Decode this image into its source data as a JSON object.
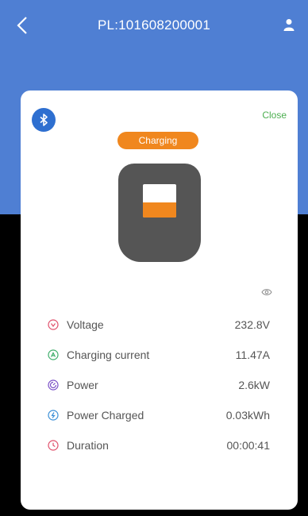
{
  "header": {
    "title": "PL:101608200001",
    "back_icon": "chevron-left-icon",
    "user_icon": "user-icon"
  },
  "card": {
    "bluetooth_icon": "bluetooth-icon",
    "close_label": "Close",
    "status": "Charging",
    "charge_level": 0.45,
    "visibility_icon": "eye-icon"
  },
  "metrics": [
    {
      "label": "Voltage",
      "value": "232.8V",
      "icon": "voltage-icon",
      "color": "#e0506b"
    },
    {
      "label": "Charging current",
      "value": "11.47A",
      "icon": "current-icon",
      "color": "#3fae6b"
    },
    {
      "label": "Power",
      "value": "2.6kW",
      "icon": "power-icon",
      "color": "#7a4fc7"
    },
    {
      "label": "Power Charged",
      "value": "0.03kWh",
      "icon": "energy-icon",
      "color": "#3b8fd6"
    },
    {
      "label": "Duration",
      "value": "00:00:41",
      "icon": "clock-icon",
      "color": "#e0506b"
    }
  ],
  "colors": {
    "header_blue": "#4f7fd3",
    "accent_orange": "#f0871e",
    "close_green": "#4caf50",
    "bluetooth_blue": "#2e6fd0"
  }
}
